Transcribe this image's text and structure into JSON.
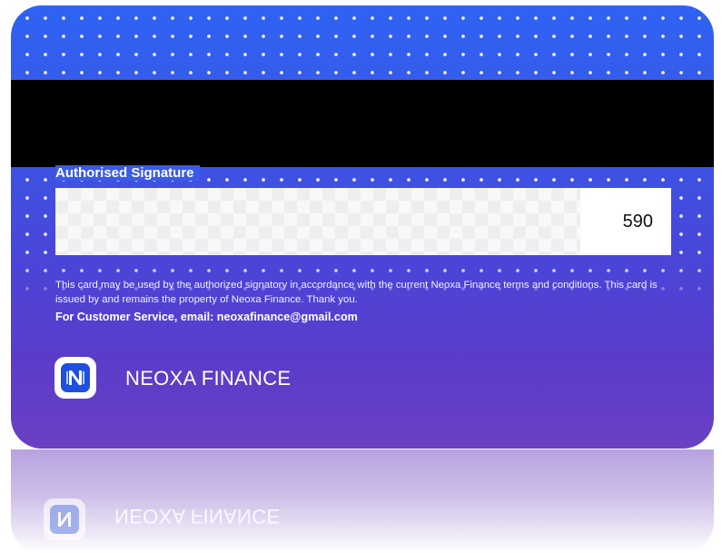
{
  "card": {
    "signature_label": "Authorised Signature",
    "cvv": "590",
    "terms_text": "This card may be used by the authorized signatory in accordance with the current Neoxa Finance terms and conditions. This card is issued by and remains the property of Neoxa Finance. Thank you.",
    "customer_service": "For Customer Service, email: neoxafinance@gmail.com",
    "brand_name": "NEOXA FINANCE",
    "logo_letter": "N"
  },
  "colors": {
    "card_gradient_top": "#2f63f2",
    "card_gradient_bottom": "#6a40c4",
    "magnetic_stripe": "#000000",
    "logo_blue": "#1f4fe0"
  },
  "icons": {
    "logo": "neoxa-n-logo-icon"
  }
}
